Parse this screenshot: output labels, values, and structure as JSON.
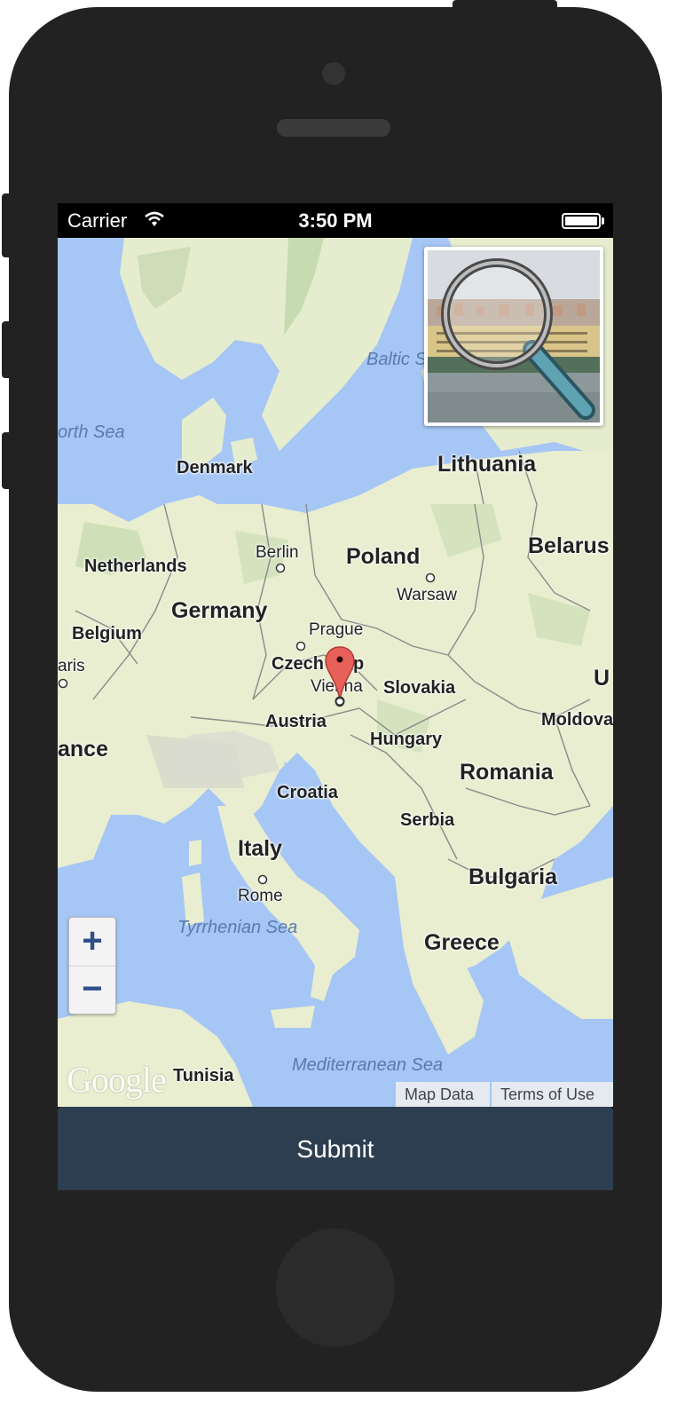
{
  "status_bar": {
    "carrier": "Carrier",
    "time": "3:50 PM",
    "icons": [
      "wifi-icon",
      "battery-icon"
    ]
  },
  "map": {
    "labels": {
      "baltic_sea": "Baltic Se",
      "north_sea": "orth Sea",
      "denmark": "Denmark",
      "lithuania": "Lithuania",
      "belarus": "Belarus",
      "netherlands": "Netherlands",
      "berlin": "Berlin",
      "poland": "Poland",
      "warsaw": "Warsaw",
      "germany": "Germany",
      "belgium": "Belgium",
      "prague": "Prague",
      "paris": "aris",
      "czech": "Czech",
      "czech_tail": "p",
      "vienna": "Vienna",
      "slovakia": "Slovakia",
      "ukraine": "U",
      "moldova": "Moldova",
      "austria": "Austria",
      "france": "ance",
      "hungary": "Hungary",
      "romania": "Romania",
      "croatia": "Croatia",
      "serbia": "Serbia",
      "italy": "Italy",
      "bulgaria": "Bulgaria",
      "rome": "Rome",
      "tyrrhenian_sea": "Tyrrhenian Sea",
      "greece": "Greece",
      "mediterranean_sea": "Mediterranean Sea",
      "tunisia": "Tunisia"
    },
    "zoom_in": "+",
    "zoom_out": "−",
    "google_logo": "Google",
    "map_data": "Map Data",
    "terms_of_use": "Terms of Use",
    "marker": "marker-pin-icon"
  },
  "photo_thumbnail": {
    "icon": "magnifier-icon"
  },
  "submit_label": "Submit",
  "colors": {
    "water": "#a6c6f5",
    "land": "#e8eecf",
    "submit_bg": "#2d3e50",
    "marker": "#e8605a",
    "zoom": "#2f4f8a"
  }
}
